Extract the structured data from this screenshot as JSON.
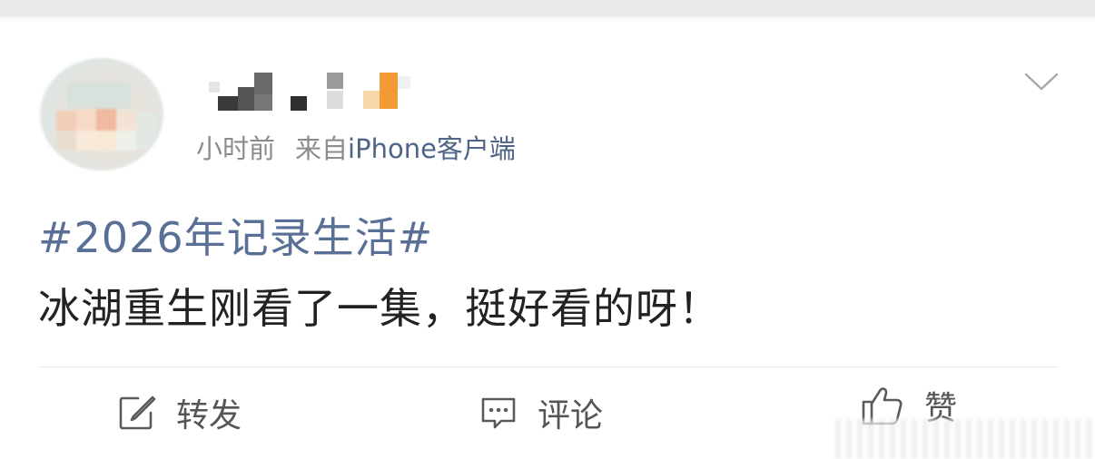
{
  "post": {
    "time": "小时前",
    "source_label": "来自",
    "source": "iPhone客户端",
    "hashtag": "#2026年记录生活#",
    "text": "冰湖重生刚看了一集，挺好看的呀！"
  },
  "actions": {
    "repost_label": "转发",
    "comment_label": "评论",
    "like_label": "赞"
  },
  "icons": {
    "menu": "chevron-down-icon",
    "repost": "share-edit-icon",
    "comment": "comment-bubble-icon",
    "like": "thumbs-up-icon"
  },
  "colors": {
    "link": "#5a6f96",
    "source": "#4f6486",
    "text": "#222222",
    "meta": "#8c8c8c",
    "action": "#555555"
  }
}
